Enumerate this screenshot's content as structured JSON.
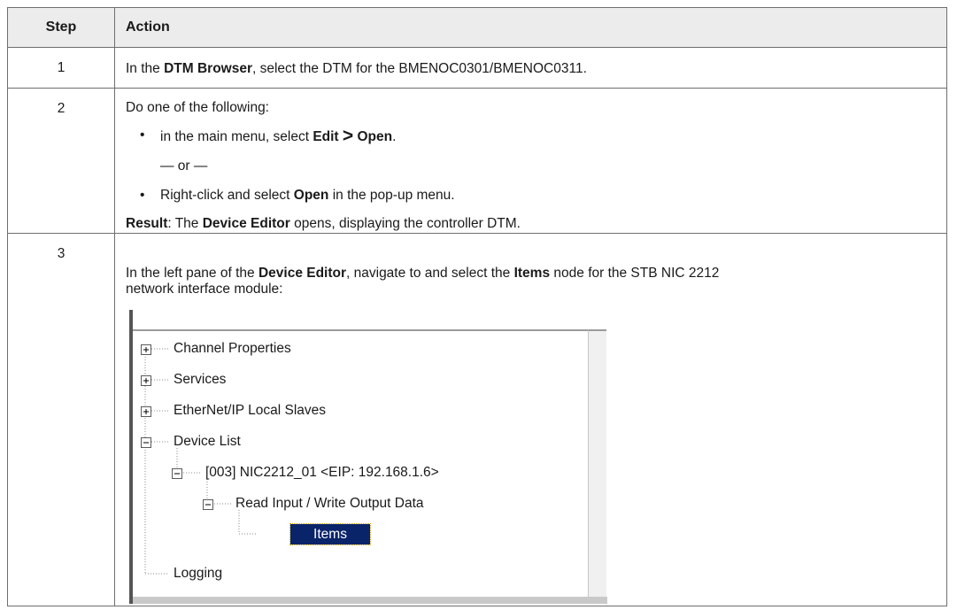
{
  "header": {
    "step": "Step",
    "action": "Action"
  },
  "rows": [
    {
      "step": "1",
      "p1": "In the ",
      "b1": "DTM Browser",
      "p2": ", select the DTM for the BMENOC0301/BMENOC0311."
    },
    {
      "step": "2",
      "intro": "Do one of the following:",
      "bullet_char": "•",
      "opt1_pre": "in the main menu, select ",
      "opt1_b1": "Edit",
      "opt1_gt": ">",
      "opt1_b2": "Open",
      "opt1_end": ".",
      "or": "— or —",
      "opt2_pre": "Right-click and select ",
      "opt2_b": "Open",
      "opt2_post": " in the pop-up menu.",
      "result_b": "Result",
      "result_p1": ": The ",
      "result_b2": "Device Editor",
      "result_p2": " opens, displaying the controller DTM."
    },
    {
      "step": "3",
      "p1": "In the left pane of the ",
      "b1": "Device Editor",
      "p2": ", navigate to and select the ",
      "b2": "Items",
      "p3": " node for the STB NIC 2212",
      "line2": "network interface module:"
    }
  ],
  "tree": {
    "items": [
      {
        "label": "Channel Properties",
        "expander": "+"
      },
      {
        "label": "Services",
        "expander": "+"
      },
      {
        "label": "EtherNet/IP Local Slaves",
        "expander": "+"
      },
      {
        "label": "Device List",
        "expander": "-"
      },
      {
        "label": "[003] NIC2212_01 <EIP: 192.168.1.6>",
        "expander": "-"
      },
      {
        "label": "Read Input / Write Output Data",
        "expander": "-"
      },
      {
        "label": "Items",
        "selected": true
      },
      {
        "label": "Logging"
      }
    ],
    "selection_color": "#0a246a"
  }
}
